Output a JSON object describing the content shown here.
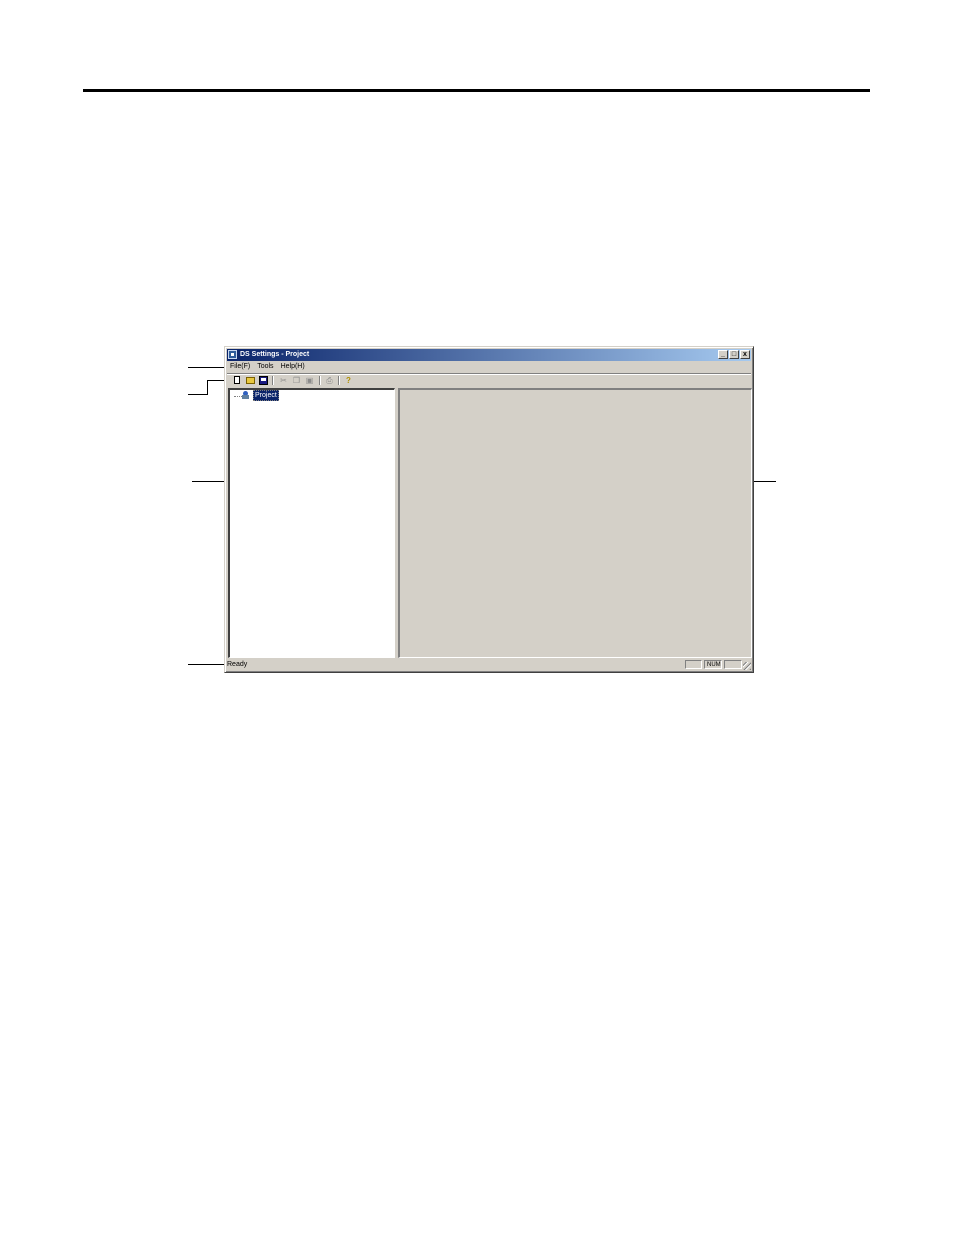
{
  "window": {
    "title": "DS Settings - Project",
    "controls": {
      "minimize": "_",
      "maximize": "□",
      "close": "x"
    }
  },
  "menu": {
    "items": [
      "File(F)",
      "Tools",
      "Help(H)"
    ]
  },
  "toolbar": {
    "icons": [
      "new-icon",
      "open-icon",
      "save-icon",
      "cut-icon",
      "copy-icon",
      "paste-icon",
      "print-icon",
      "help-icon"
    ]
  },
  "tree": {
    "root_label": "Project"
  },
  "status": {
    "text": "Ready",
    "indicators": [
      "",
      "NUM",
      ""
    ]
  }
}
